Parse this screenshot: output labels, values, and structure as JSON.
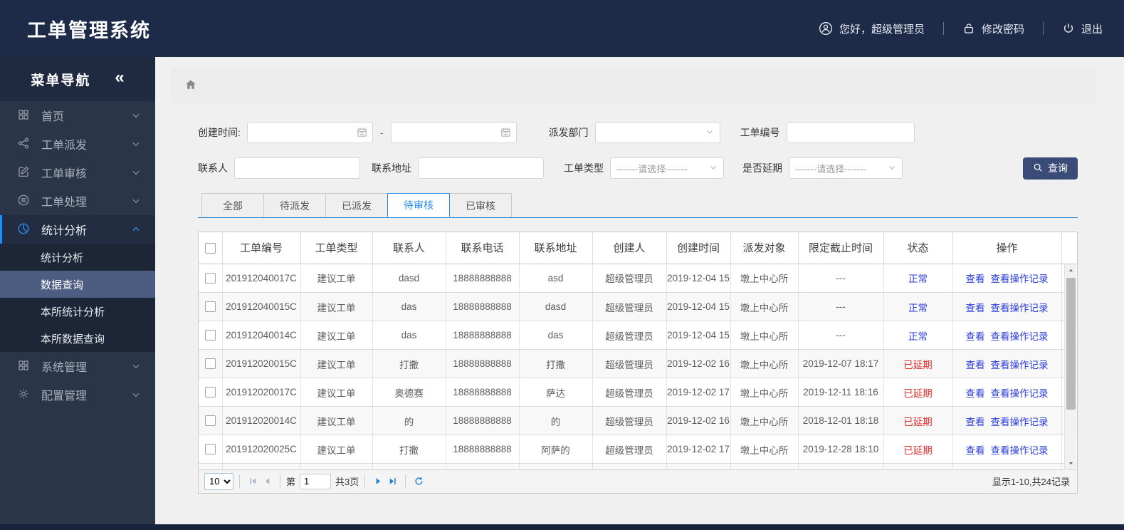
{
  "header": {
    "title": "工单管理系统",
    "greeting": "您好，超级管理员",
    "change_password": "修改密码",
    "logout": "退出"
  },
  "sidebar": {
    "title": "菜单导航",
    "collapse_glyph": "«",
    "items": [
      {
        "label": "首页",
        "icon": "grid-icon"
      },
      {
        "label": "工单派发",
        "icon": "share-icon"
      },
      {
        "label": "工单审核",
        "icon": "edit-icon"
      },
      {
        "label": "工单处理",
        "icon": "process-icon"
      },
      {
        "label": "统计分析",
        "icon": "pie-icon"
      },
      {
        "label": "系统管理",
        "icon": "modules-icon"
      },
      {
        "label": "配置管理",
        "icon": "gear-icon"
      }
    ],
    "submenu": {
      "items": [
        {
          "label": "统计分析"
        },
        {
          "label": "数据查询"
        },
        {
          "label": "本所统计分析"
        },
        {
          "label": "本所数据查询"
        }
      ],
      "active": "数据查询"
    }
  },
  "filters": {
    "created_time_label": "创建时间:",
    "date_separator": "-",
    "dispatch_dept_label": "派发部门",
    "dispatch_dept_value": "",
    "order_no_label": "工单编号",
    "contact_label": "联系人",
    "address_label": "联系地址",
    "order_type_label": "工单类型",
    "delayed_label": "是否延期",
    "select_placeholder": "-------请选择-------",
    "search_button": "查询"
  },
  "tabs": {
    "items": [
      {
        "label": "全部"
      },
      {
        "label": "待派发"
      },
      {
        "label": "已派发"
      },
      {
        "label": "待审核"
      },
      {
        "label": "已审核"
      }
    ],
    "active": "待审核"
  },
  "table": {
    "headers": [
      "工单编号",
      "工单类型",
      "联系人",
      "联系电话",
      "联系地址",
      "创建人",
      "创建时间",
      "派发对象",
      "限定截止时间",
      "状态",
      "操作"
    ],
    "action_view": "查看",
    "action_log": "查看操作记录",
    "rows": [
      {
        "order_no": "201912040017C",
        "type": "建议工单",
        "contact": "dasd",
        "phone": "18888888888",
        "address": "asd",
        "creator": "超级管理员",
        "created": "2019-12-04 15",
        "target": "墩上中心所",
        "deadline": "---",
        "status": "正常",
        "status_type": "normal"
      },
      {
        "order_no": "201912040015C",
        "type": "建议工单",
        "contact": "das",
        "phone": "18888888888",
        "address": "dasd",
        "creator": "超级管理员",
        "created": "2019-12-04 15",
        "target": "墩上中心所",
        "deadline": "---",
        "status": "正常",
        "status_type": "normal"
      },
      {
        "order_no": "201912040014C",
        "type": "建议工单",
        "contact": "das",
        "phone": "18888888888",
        "address": "das",
        "creator": "超级管理员",
        "created": "2019-12-04 15",
        "target": "墩上中心所",
        "deadline": "---",
        "status": "正常",
        "status_type": "normal"
      },
      {
        "order_no": "201912020015C",
        "type": "建议工单",
        "contact": "打撒",
        "phone": "18888888888",
        "address": "打撒",
        "creator": "超级管理员",
        "created": "2019-12-02 16",
        "target": "墩上中心所",
        "deadline": "2019-12-07 18:17",
        "status": "已延期",
        "status_type": "delayed"
      },
      {
        "order_no": "201912020017C",
        "type": "建议工单",
        "contact": "奥德赛",
        "phone": "18888888888",
        "address": "萨达",
        "creator": "超级管理员",
        "created": "2019-12-02 17",
        "target": "墩上中心所",
        "deadline": "2019-12-11 18:16",
        "status": "已延期",
        "status_type": "delayed"
      },
      {
        "order_no": "201912020014C",
        "type": "建议工单",
        "contact": "的",
        "phone": "18888888888",
        "address": "的",
        "creator": "超级管理员",
        "created": "2019-12-02 16",
        "target": "墩上中心所",
        "deadline": "2018-12-01 18:18",
        "status": "已延期",
        "status_type": "delayed"
      },
      {
        "order_no": "201912020025C",
        "type": "建议工单",
        "contact": "打撒",
        "phone": "18888888888",
        "address": "阿萨的",
        "creator": "超级管理员",
        "created": "2019-12-02 17",
        "target": "墩上中心所",
        "deadline": "2019-12-28 18:10",
        "status": "已延期",
        "status_type": "delayed"
      },
      {
        "order_no": "",
        "type": "",
        "contact": "",
        "phone": "",
        "address": "",
        "creator": "",
        "created": "",
        "target": "",
        "deadline": "",
        "status": "",
        "status_type": "none"
      }
    ]
  },
  "pagination": {
    "page_size": "10",
    "page_prefix": "第",
    "current_page": "1",
    "total_pages": "共3页",
    "summary": "显示1-10,共24记录"
  },
  "colors": {
    "header_navy": "#1d2b49",
    "sidebar_dark": "#2a3547",
    "accent_blue": "#2d8cf0",
    "link_blue": "#2b3dd8",
    "danger_red": "#e02e2e",
    "button_navy": "#3a4b78"
  }
}
